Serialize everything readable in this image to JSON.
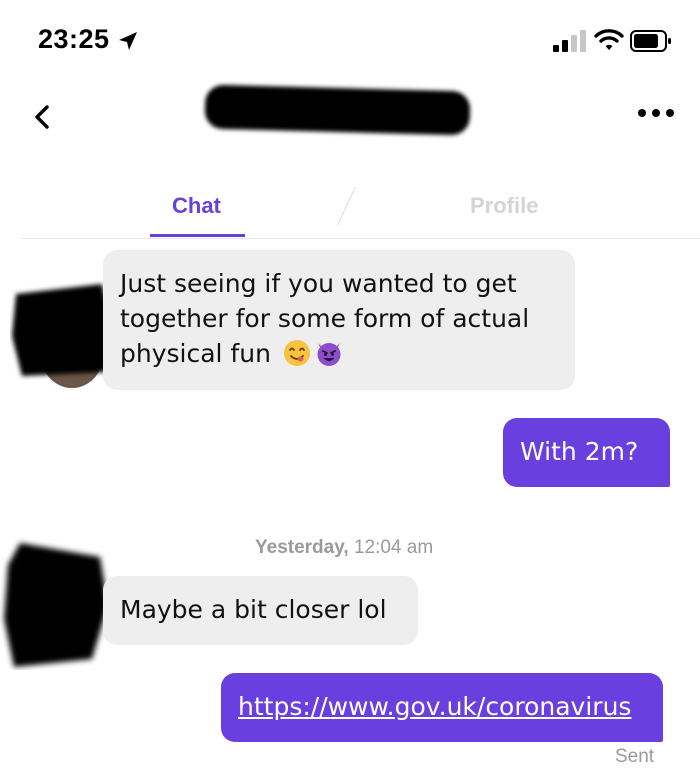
{
  "status_bar": {
    "time": "23:25",
    "icons": [
      "location-arrow-icon",
      "signal-icon",
      "wifi-icon",
      "battery-icon"
    ]
  },
  "nav": {
    "back_icon": "chevron-left-icon",
    "more_icon": "more-horizontal-icon"
  },
  "tabs": [
    {
      "label": "Chat",
      "active": true
    },
    {
      "label": "Profile",
      "active": false
    }
  ],
  "colors": {
    "accent": "#6a3fe0",
    "incoming_bubble": "#eeeeee",
    "meta_text": "#9a9a9a"
  },
  "messages": [
    {
      "direction": "incoming",
      "text": "Just seeing if you wanted to get together for some form of actual physical fun",
      "emojis": [
        "yum-face-emoji",
        "smiling-devil-emoji"
      ]
    },
    {
      "direction": "outgoing",
      "text": "With 2m?"
    },
    {
      "direction": "incoming",
      "timestamp_day": "Yesterday,",
      "timestamp_time": "12:04 am",
      "text": "Maybe a bit closer lol"
    },
    {
      "direction": "outgoing",
      "text": "https://www.gov.uk/coronavirus",
      "status": "Sent"
    }
  ]
}
